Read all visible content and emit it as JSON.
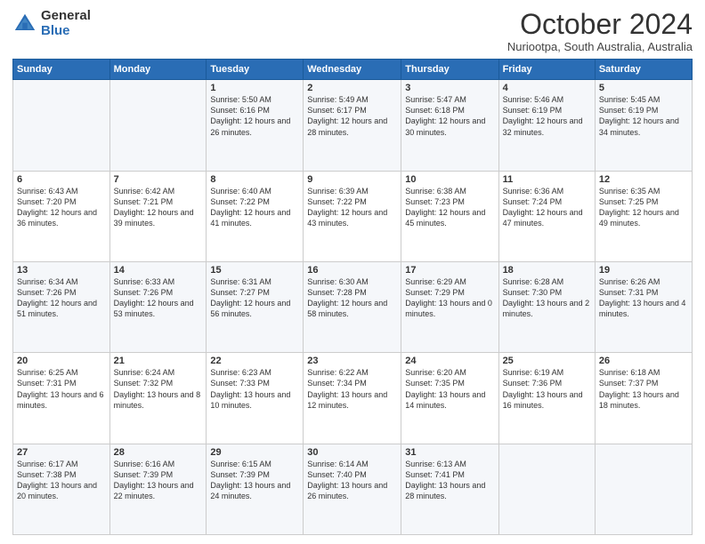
{
  "header": {
    "logo_general": "General",
    "logo_blue": "Blue",
    "month": "October 2024",
    "location": "Nuriootpa, South Australia, Australia"
  },
  "weekdays": [
    "Sunday",
    "Monday",
    "Tuesday",
    "Wednesday",
    "Thursday",
    "Friday",
    "Saturday"
  ],
  "weeks": [
    [
      {
        "day": "",
        "info": ""
      },
      {
        "day": "",
        "info": ""
      },
      {
        "day": "1",
        "info": "Sunrise: 5:50 AM\nSunset: 6:16 PM\nDaylight: 12 hours and 26 minutes."
      },
      {
        "day": "2",
        "info": "Sunrise: 5:49 AM\nSunset: 6:17 PM\nDaylight: 12 hours and 28 minutes."
      },
      {
        "day": "3",
        "info": "Sunrise: 5:47 AM\nSunset: 6:18 PM\nDaylight: 12 hours and 30 minutes."
      },
      {
        "day": "4",
        "info": "Sunrise: 5:46 AM\nSunset: 6:19 PM\nDaylight: 12 hours and 32 minutes."
      },
      {
        "day": "5",
        "info": "Sunrise: 5:45 AM\nSunset: 6:19 PM\nDaylight: 12 hours and 34 minutes."
      }
    ],
    [
      {
        "day": "6",
        "info": "Sunrise: 6:43 AM\nSunset: 7:20 PM\nDaylight: 12 hours and 36 minutes."
      },
      {
        "day": "7",
        "info": "Sunrise: 6:42 AM\nSunset: 7:21 PM\nDaylight: 12 hours and 39 minutes."
      },
      {
        "day": "8",
        "info": "Sunrise: 6:40 AM\nSunset: 7:22 PM\nDaylight: 12 hours and 41 minutes."
      },
      {
        "day": "9",
        "info": "Sunrise: 6:39 AM\nSunset: 7:22 PM\nDaylight: 12 hours and 43 minutes."
      },
      {
        "day": "10",
        "info": "Sunrise: 6:38 AM\nSunset: 7:23 PM\nDaylight: 12 hours and 45 minutes."
      },
      {
        "day": "11",
        "info": "Sunrise: 6:36 AM\nSunset: 7:24 PM\nDaylight: 12 hours and 47 minutes."
      },
      {
        "day": "12",
        "info": "Sunrise: 6:35 AM\nSunset: 7:25 PM\nDaylight: 12 hours and 49 minutes."
      }
    ],
    [
      {
        "day": "13",
        "info": "Sunrise: 6:34 AM\nSunset: 7:26 PM\nDaylight: 12 hours and 51 minutes."
      },
      {
        "day": "14",
        "info": "Sunrise: 6:33 AM\nSunset: 7:26 PM\nDaylight: 12 hours and 53 minutes."
      },
      {
        "day": "15",
        "info": "Sunrise: 6:31 AM\nSunset: 7:27 PM\nDaylight: 12 hours and 56 minutes."
      },
      {
        "day": "16",
        "info": "Sunrise: 6:30 AM\nSunset: 7:28 PM\nDaylight: 12 hours and 58 minutes."
      },
      {
        "day": "17",
        "info": "Sunrise: 6:29 AM\nSunset: 7:29 PM\nDaylight: 13 hours and 0 minutes."
      },
      {
        "day": "18",
        "info": "Sunrise: 6:28 AM\nSunset: 7:30 PM\nDaylight: 13 hours and 2 minutes."
      },
      {
        "day": "19",
        "info": "Sunrise: 6:26 AM\nSunset: 7:31 PM\nDaylight: 13 hours and 4 minutes."
      }
    ],
    [
      {
        "day": "20",
        "info": "Sunrise: 6:25 AM\nSunset: 7:31 PM\nDaylight: 13 hours and 6 minutes."
      },
      {
        "day": "21",
        "info": "Sunrise: 6:24 AM\nSunset: 7:32 PM\nDaylight: 13 hours and 8 minutes."
      },
      {
        "day": "22",
        "info": "Sunrise: 6:23 AM\nSunset: 7:33 PM\nDaylight: 13 hours and 10 minutes."
      },
      {
        "day": "23",
        "info": "Sunrise: 6:22 AM\nSunset: 7:34 PM\nDaylight: 13 hours and 12 minutes."
      },
      {
        "day": "24",
        "info": "Sunrise: 6:20 AM\nSunset: 7:35 PM\nDaylight: 13 hours and 14 minutes."
      },
      {
        "day": "25",
        "info": "Sunrise: 6:19 AM\nSunset: 7:36 PM\nDaylight: 13 hours and 16 minutes."
      },
      {
        "day": "26",
        "info": "Sunrise: 6:18 AM\nSunset: 7:37 PM\nDaylight: 13 hours and 18 minutes."
      }
    ],
    [
      {
        "day": "27",
        "info": "Sunrise: 6:17 AM\nSunset: 7:38 PM\nDaylight: 13 hours and 20 minutes."
      },
      {
        "day": "28",
        "info": "Sunrise: 6:16 AM\nSunset: 7:39 PM\nDaylight: 13 hours and 22 minutes."
      },
      {
        "day": "29",
        "info": "Sunrise: 6:15 AM\nSunset: 7:39 PM\nDaylight: 13 hours and 24 minutes."
      },
      {
        "day": "30",
        "info": "Sunrise: 6:14 AM\nSunset: 7:40 PM\nDaylight: 13 hours and 26 minutes."
      },
      {
        "day": "31",
        "info": "Sunrise: 6:13 AM\nSunset: 7:41 PM\nDaylight: 13 hours and 28 minutes."
      },
      {
        "day": "",
        "info": ""
      },
      {
        "day": "",
        "info": ""
      }
    ]
  ]
}
